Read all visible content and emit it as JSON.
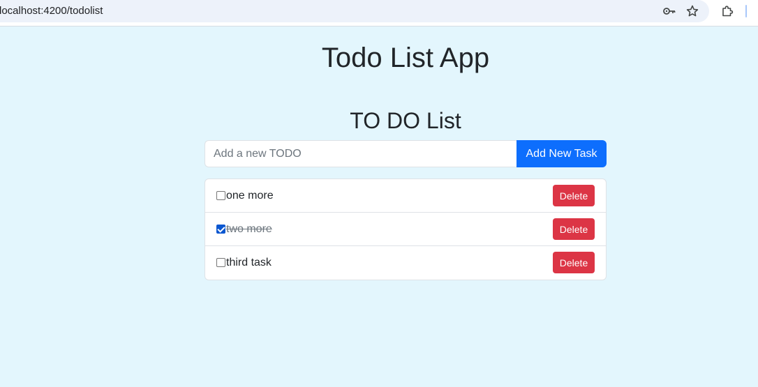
{
  "browser": {
    "url": "localhost:4200/todolist",
    "icons": [
      "password-key-icon",
      "bookmark-star-icon",
      "extensions-icon"
    ]
  },
  "app": {
    "title": "Todo List App"
  },
  "todo": {
    "heading": "TO DO List",
    "input_placeholder": "Add a new TODO",
    "input_value": "",
    "add_label": "Add New Task",
    "items": [
      {
        "text": "one more",
        "done": false,
        "delete_label": "Delete"
      },
      {
        "text": "two more",
        "done": true,
        "delete_label": "Delete"
      },
      {
        "text": "third task",
        "done": false,
        "delete_label": "Delete"
      }
    ]
  },
  "colors": {
    "page_background": "#e3f6fd",
    "primary": "#0d6efd",
    "danger": "#dc3545"
  }
}
